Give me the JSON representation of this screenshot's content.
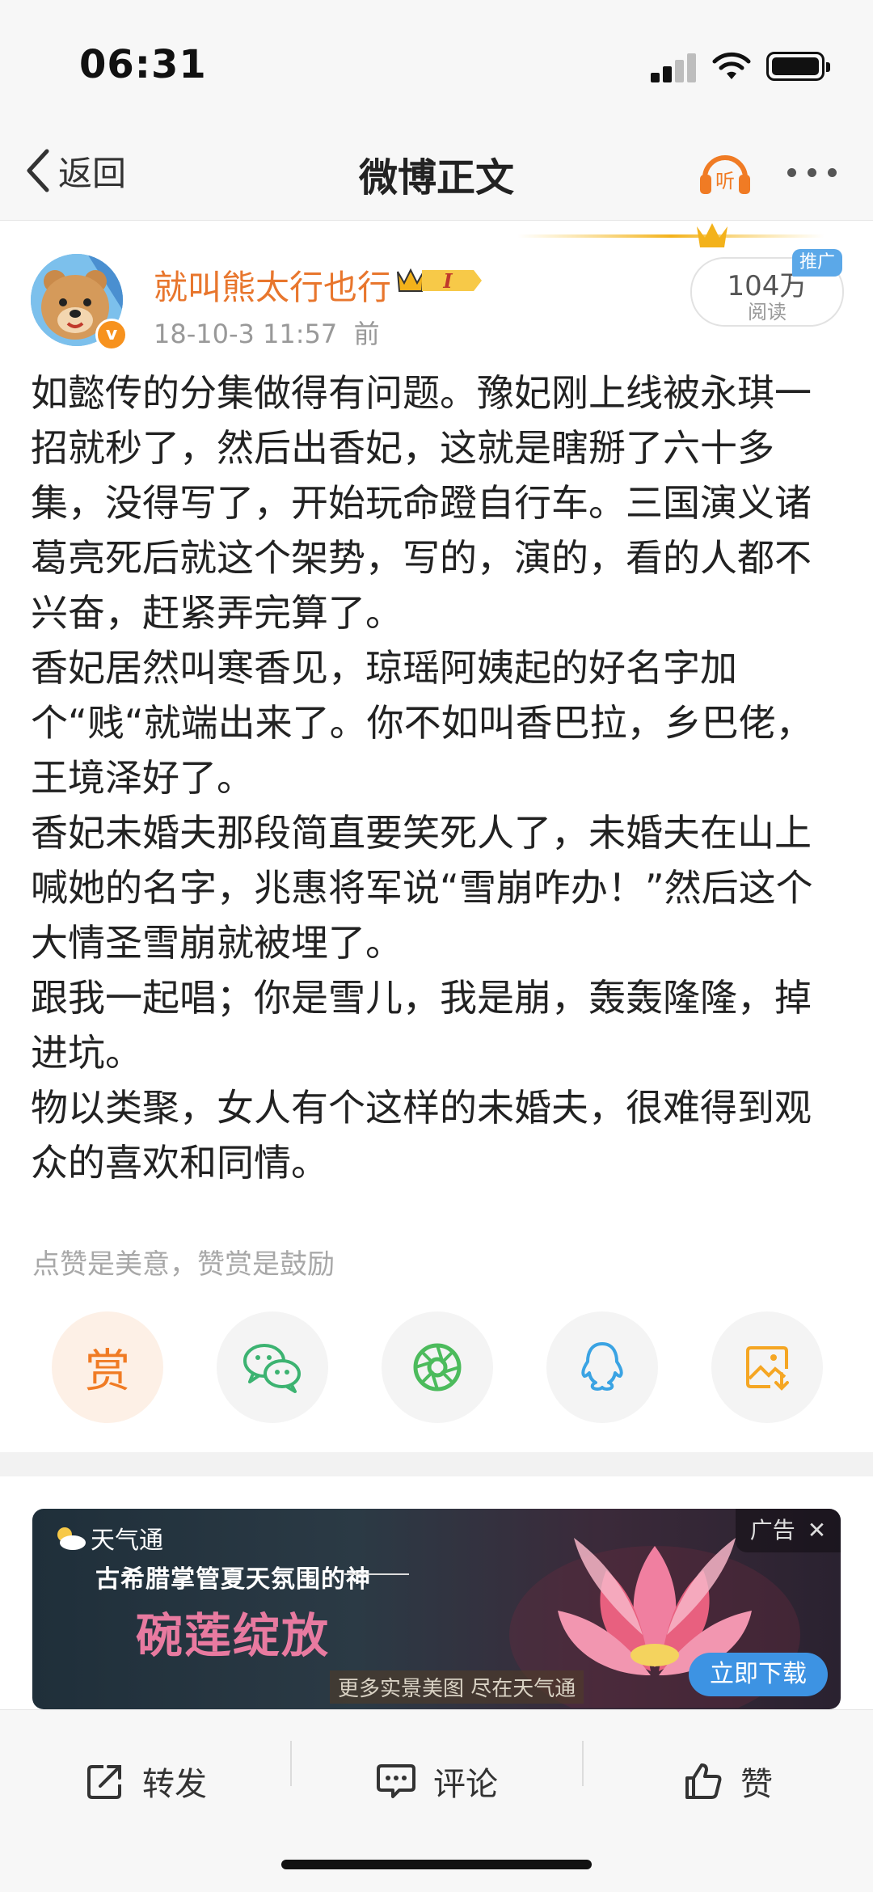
{
  "status_bar": {
    "time": "06:31"
  },
  "nav": {
    "back_label": "返回",
    "title": "微博正文",
    "listen_label": "听"
  },
  "post": {
    "username": "就叫熊太行也行",
    "level_badge": "I",
    "verified_mark": "v",
    "time": "18-10-3 11:57",
    "time_suffix": "前",
    "read_count": "104万",
    "read_label": "阅读",
    "promo_tag": "推广",
    "paragraphs": [
      "如懿传的分集做得有问题。豫妃刚上线被永琪一招就秒了，然后出香妃，这就是瞎掰了六十多集，没得写了，开始玩命蹬自行车。三国演义诸葛亮死后就这个架势，写的，演的，看的人都不兴奋，赶紧弄完算了。",
      "香妃居然叫寒香见，琼瑶阿姨起的好名字加个“贱“就端出来了。你不如叫香巴拉，乡巴佬，王境泽好了。",
      "香妃未婚夫那段简直要笑死人了，未婚夫在山上喊她的名字，兆惠将军说“雪崩咋办！”然后这个大情圣雪崩就被埋了。",
      "跟我一起唱；你是雪儿，我是崩，轰轰隆隆，掉进坑。",
      "物以类聚，女人有个这样的未婚夫，很难得到观众的喜欢和同情。"
    ]
  },
  "reward": {
    "tip": "点赞是美意，赞赏是鼓励",
    "button_char": "赏"
  },
  "share": {
    "items": [
      "reward-icon",
      "wechat-icon",
      "moments-icon",
      "qq-icon",
      "save-image-icon"
    ],
    "colors": {
      "reward": "#f07b24",
      "wechat": "#3cb371",
      "moments": "#4cbb5c",
      "qq": "#3aa3e3",
      "save": "#f5a623"
    }
  },
  "ad": {
    "brand": "天气通",
    "headline": "古希腊掌管夏天氛围的神",
    "title": "碗莲绽放",
    "subtitle": "更多实景美图 尽在天气通",
    "label": "广告",
    "close": "✕",
    "cta": "立即下载"
  },
  "bottom_bar": {
    "repost": "转发",
    "comment": "评论",
    "like": "赞"
  },
  "theme": {
    "accent_orange": "#e8762d",
    "link_blue": "#3d93e3"
  }
}
